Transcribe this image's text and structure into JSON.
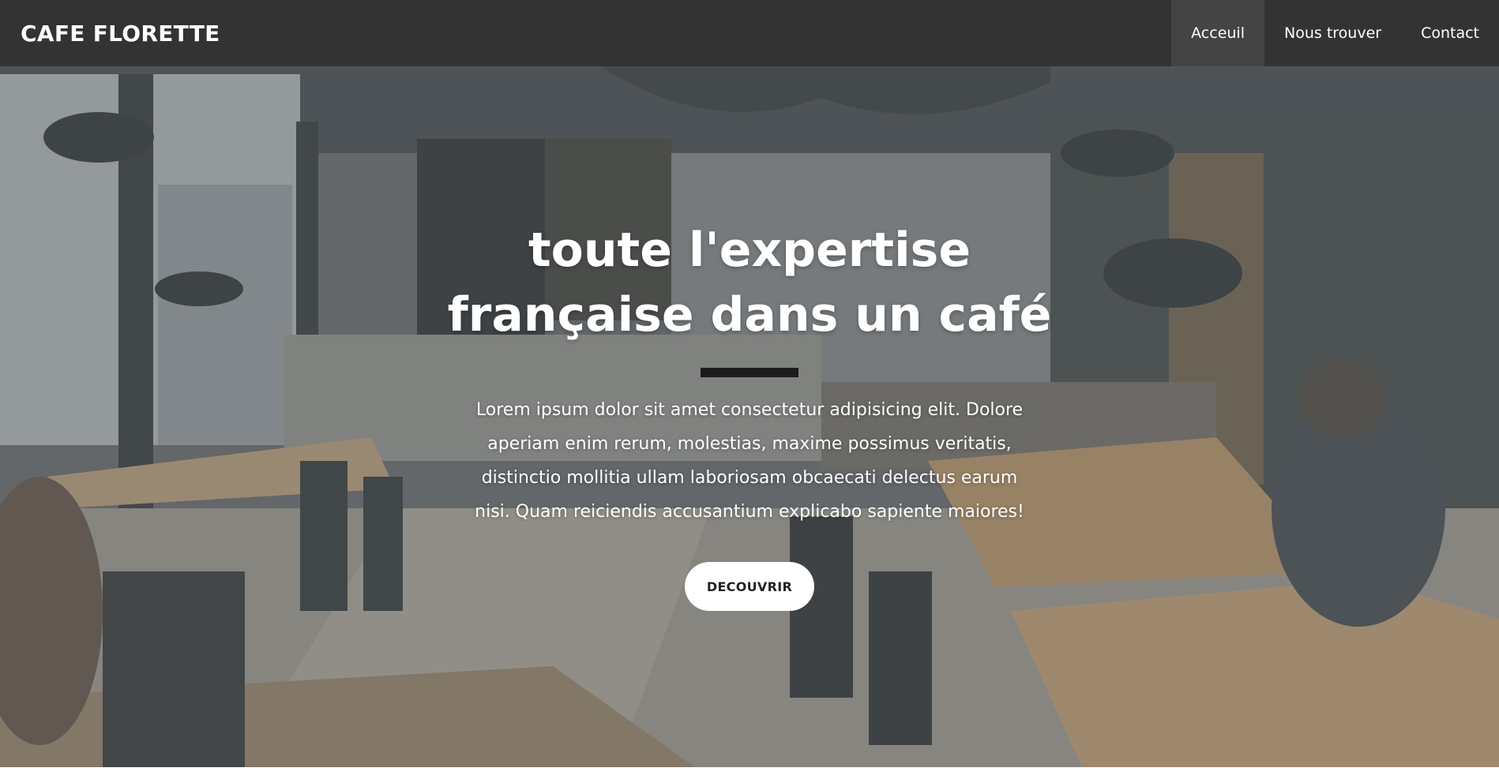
{
  "navbar": {
    "brand": "CAFE FLORETTE",
    "links": [
      {
        "label": "Acceuil",
        "active": true
      },
      {
        "label": "Nous trouver",
        "active": false
      },
      {
        "label": "Contact",
        "active": false
      }
    ]
  },
  "hero": {
    "title": "toute l'expertise française dans un café",
    "text": "Lorem ipsum dolor sit amet consectetur adipisicing elit. Dolore aperiam enim rerum, molestias, maxime possimus veritatis, distinctio mollitia ullam laboriosam obcaecati delectus earum nisi. Quam reiciendis accusantium explicabo sapiente maiores!",
    "button_label": "DECOUVRIR"
  },
  "colors": {
    "navbar_bg": "#333333",
    "nav_active_bg": "#444444",
    "divider": "#1b1b1b",
    "button_bg": "#ffffff"
  }
}
